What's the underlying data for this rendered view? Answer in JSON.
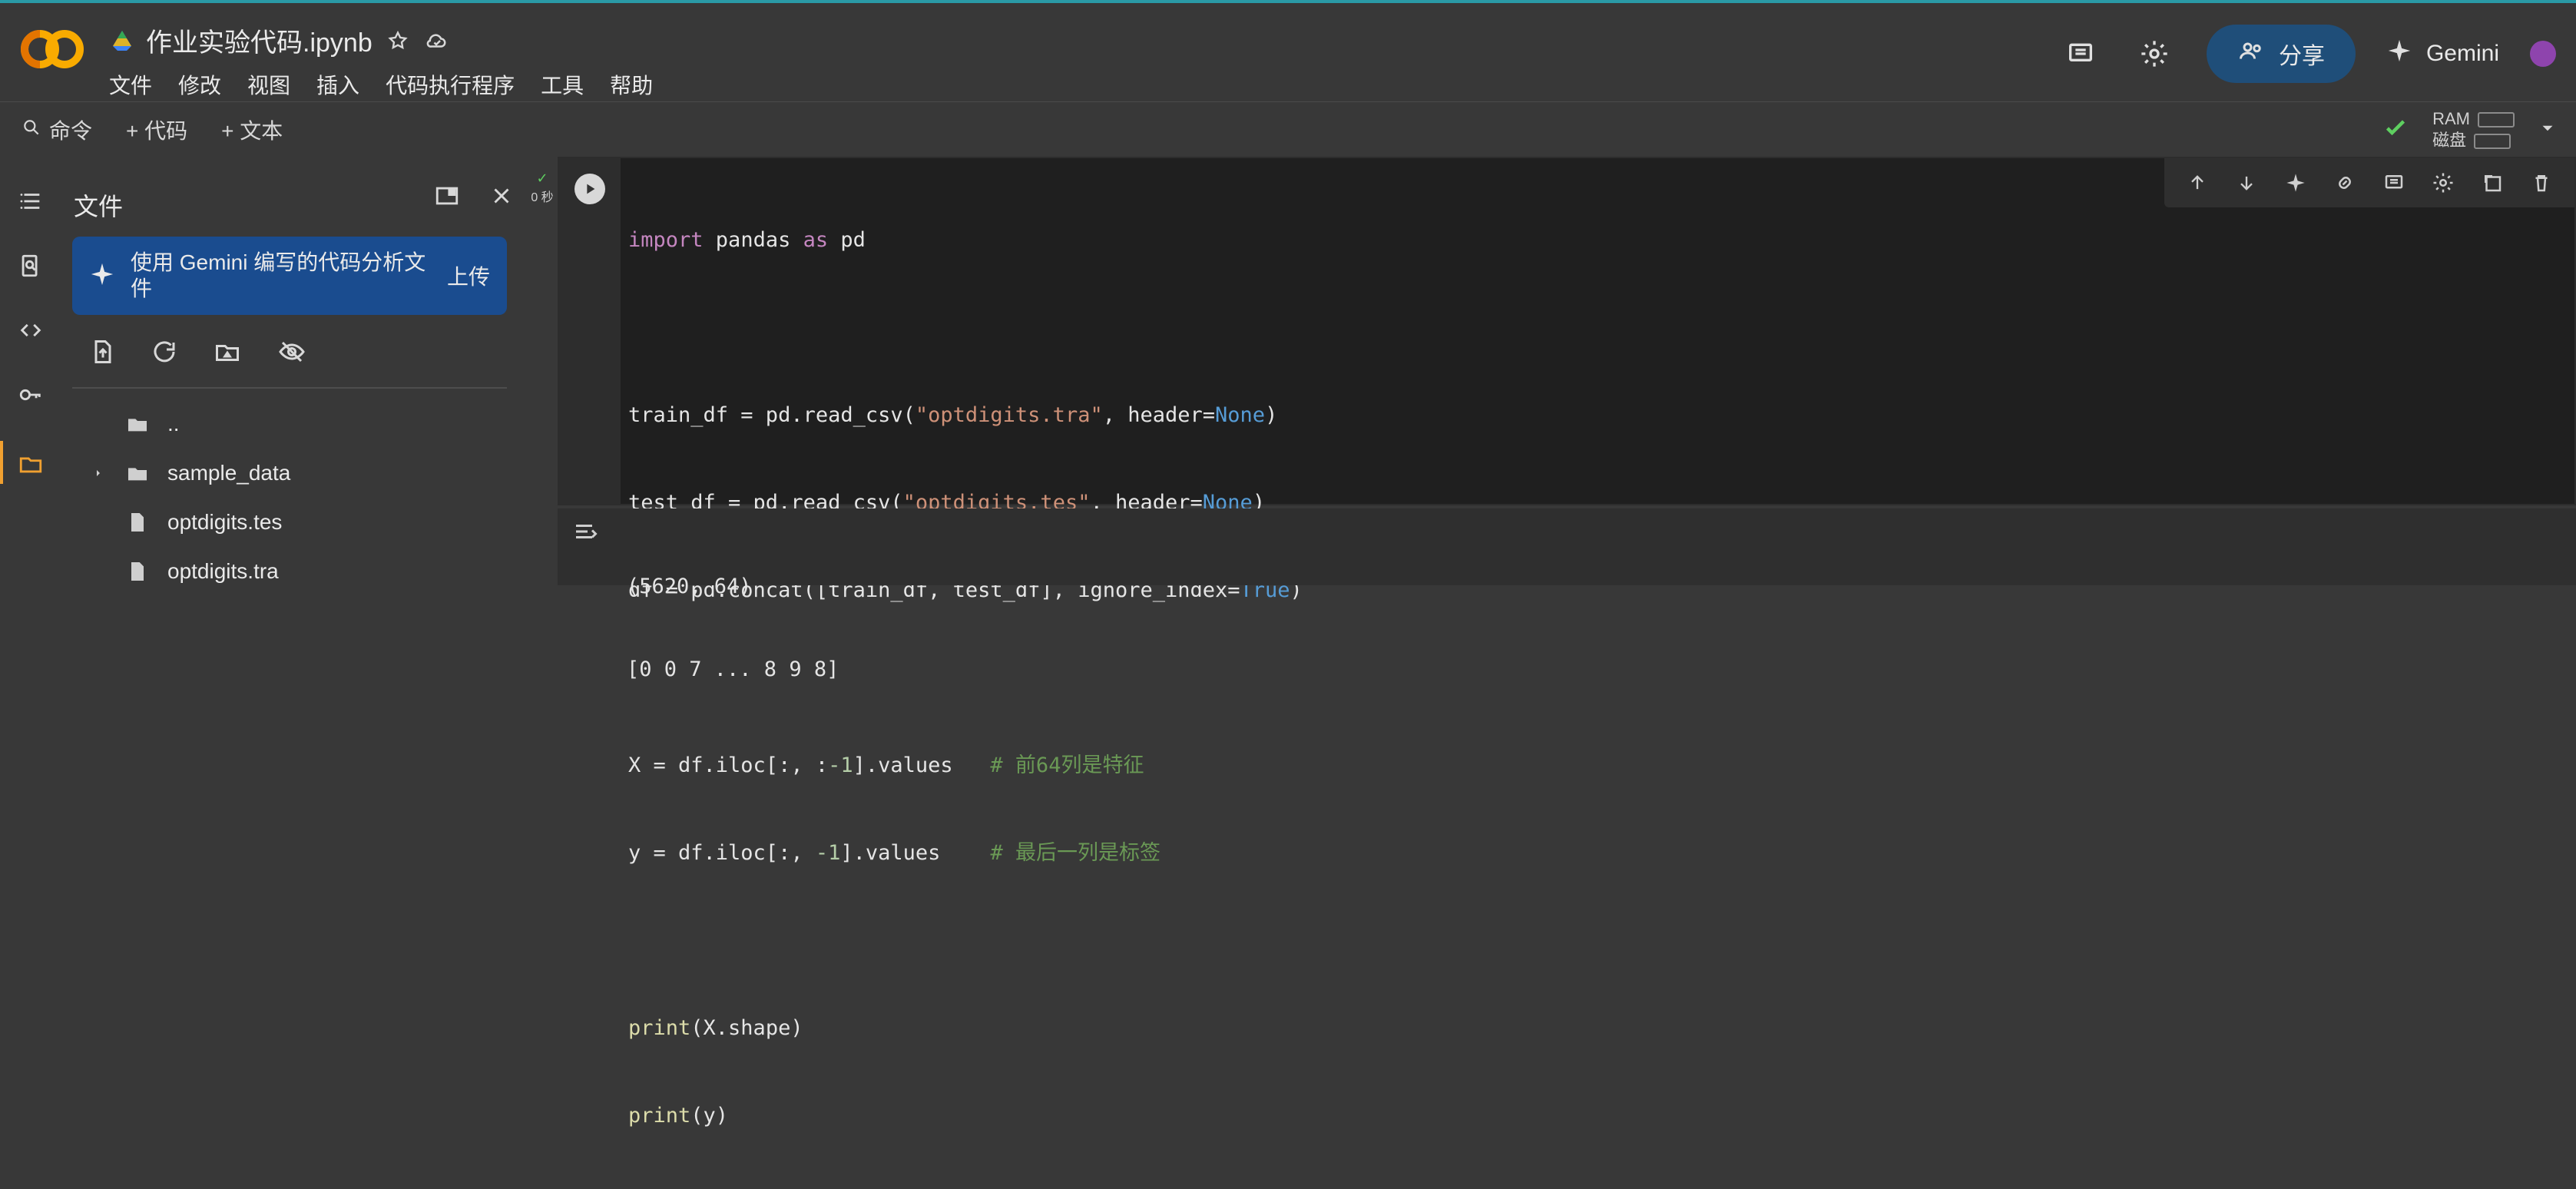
{
  "app": {
    "filename": "作业实验代码.ipynb",
    "menus": [
      "文件",
      "修改",
      "视图",
      "插入",
      "代码执行程序",
      "工具",
      "帮助"
    ],
    "share_label": "分享",
    "gemini_label": "Gemini",
    "icons": {
      "logo": "colab-logo",
      "drive": "drive-icon",
      "star": "star-icon",
      "cloud": "cloud-icon",
      "comment": "comment-icon",
      "settings": "gear-icon",
      "share": "people-icon",
      "gemini": "sparkle-icon"
    }
  },
  "toolbar": {
    "command_label": "命令",
    "add_code_label": "+ 代码",
    "add_text_label": "+ 文本",
    "ram_label": "RAM",
    "disk_label": "磁盘"
  },
  "sidebar": {
    "title": "文件",
    "gemini_card_text": "使用 Gemini 编写的代码分析文件",
    "upload_label": "上传",
    "tree": [
      {
        "type": "folder",
        "name": "..",
        "expandable": false
      },
      {
        "type": "folder",
        "name": "sample_data",
        "expandable": true
      },
      {
        "type": "file",
        "name": "optdigits.tes",
        "expandable": false
      },
      {
        "type": "file",
        "name": "optdigits.tra",
        "expandable": false
      }
    ]
  },
  "cell": {
    "exec_time": "0 秒",
    "code_lines": [
      "import pandas as pd",
      "",
      "train_df = pd.read_csv(\"optdigits.tra\", header=None)",
      "test_df = pd.read_csv(\"optdigits.tes\", header=None)",
      "df = pd.concat([train_df, test_df], ignore_index=True)",
      "",
      "X = df.iloc[:, :-1].values   # 前64列是特征",
      "y = df.iloc[:, -1].values    # 最后一列是标签",
      "",
      "print(X.shape)",
      "print(y)"
    ],
    "output_lines": [
      "(5620, 64)",
      "[0 0 7 ... 8 9 8]"
    ]
  }
}
